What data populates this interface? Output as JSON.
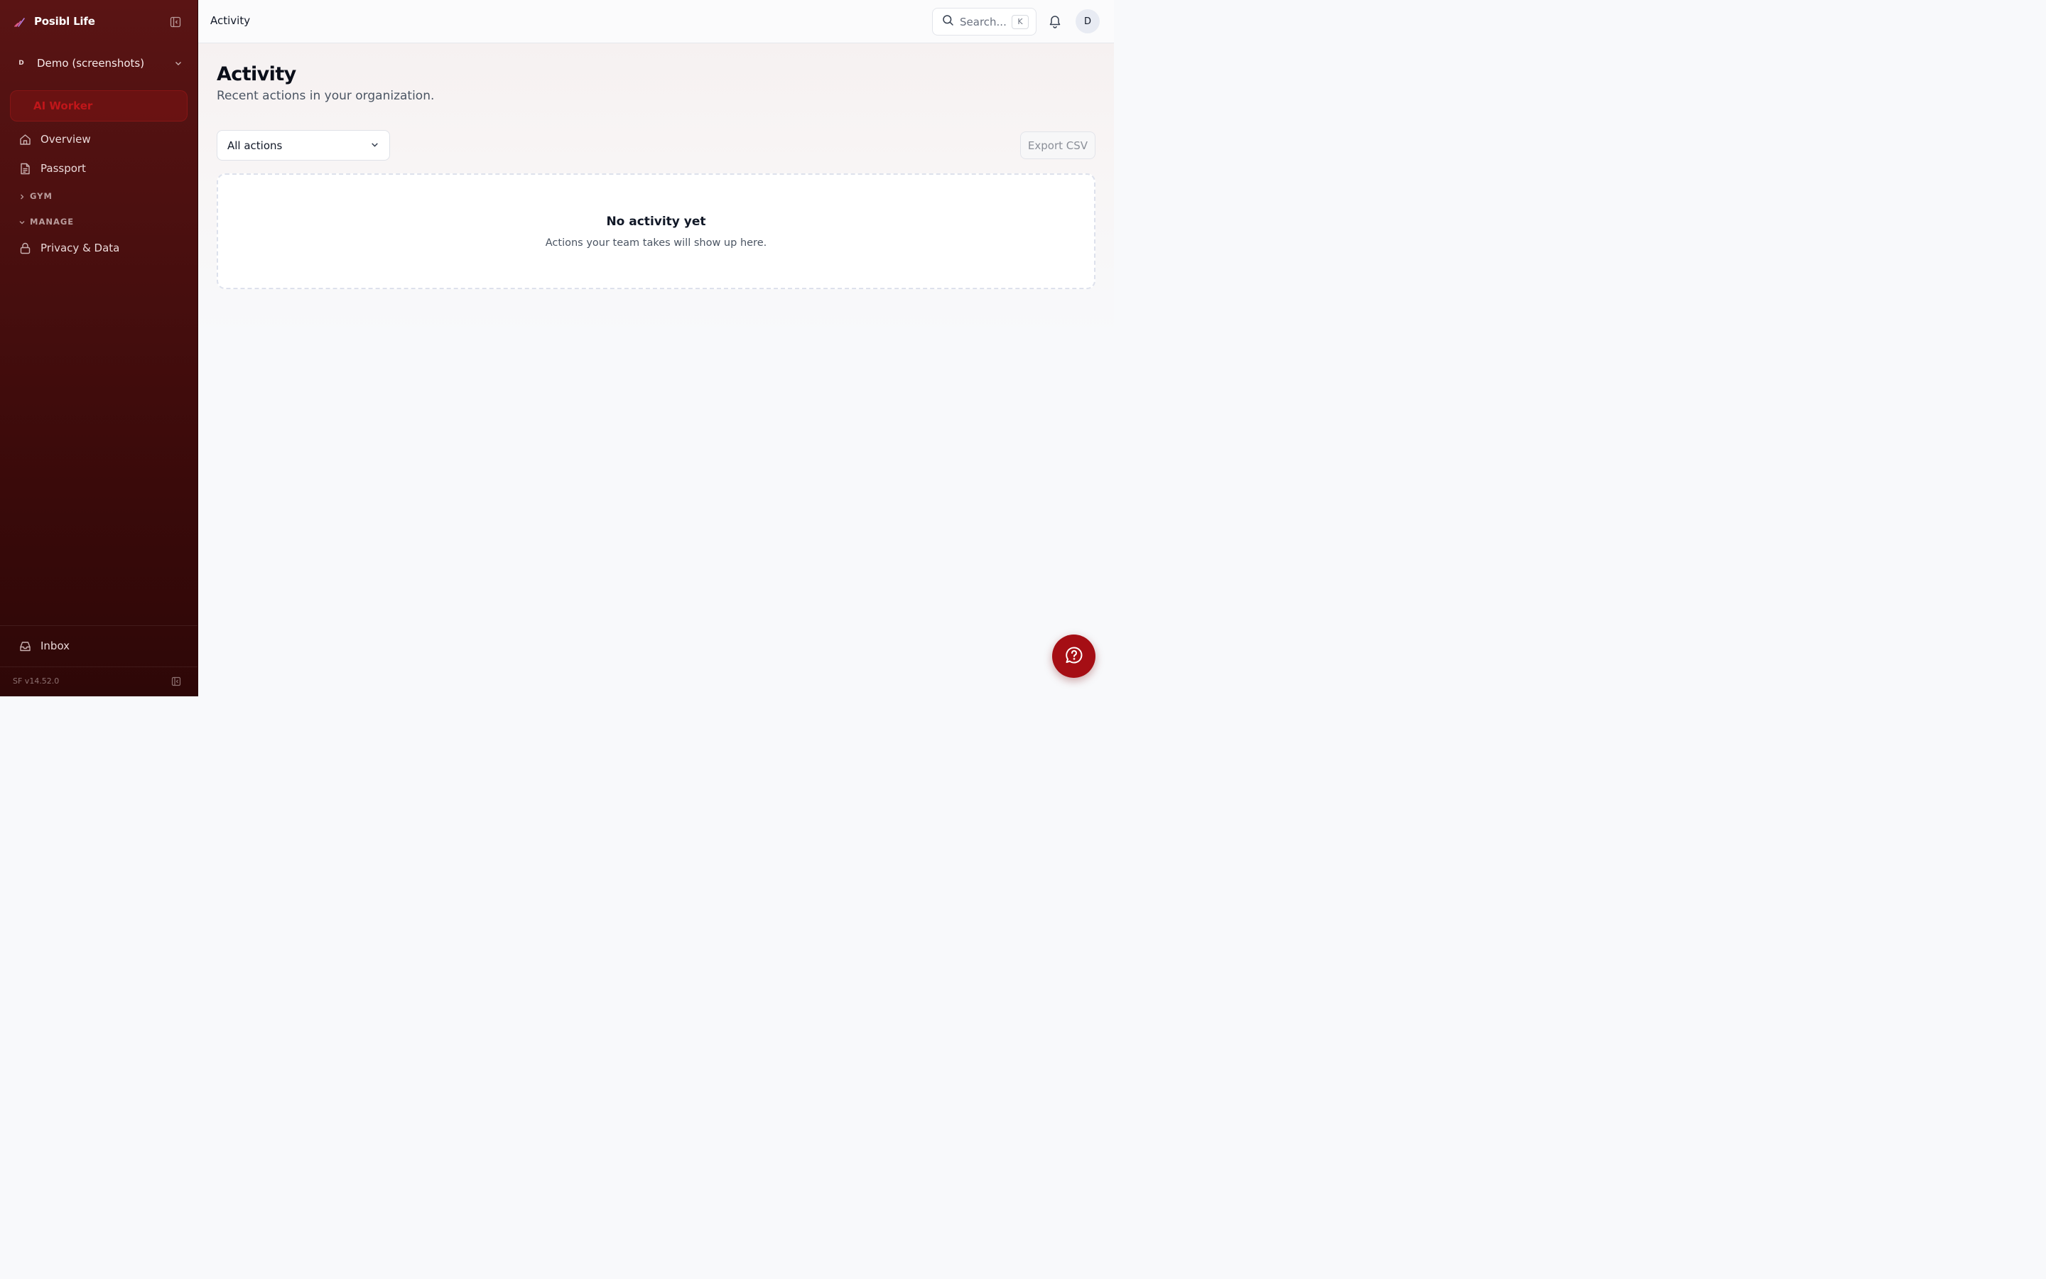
{
  "app": {
    "brand_name": "Posibl Life",
    "version": "SF v14.52.0"
  },
  "sidebar": {
    "org": {
      "avatar_letter": "D",
      "name": "Demo (screenshots)"
    },
    "ai_worker_label": "AI Worker",
    "items": [
      {
        "label": "Overview",
        "icon": "home-icon"
      },
      {
        "label": "Passport",
        "icon": "document-icon"
      }
    ],
    "sections": [
      {
        "label": "GYM",
        "expanded": false
      },
      {
        "label": "MANAGE",
        "expanded": true,
        "items": [
          {
            "label": "Privacy & Data",
            "icon": "lock-icon"
          }
        ]
      }
    ],
    "bottom_item": {
      "label": "Inbox",
      "icon": "inbox-icon"
    }
  },
  "topbar": {
    "title": "Activity",
    "search_placeholder": "Search...",
    "search_shortcut": "K",
    "user_avatar_letter": "D"
  },
  "main": {
    "title": "Activity",
    "subtitle": "Recent actions in your organization.",
    "filter": {
      "selected": "All actions"
    },
    "export_label": "Export CSV",
    "empty_state": {
      "title": "No activity yet",
      "description": "Actions your team takes will show up here."
    }
  },
  "colors": {
    "sidebar_top": "#5a1414",
    "sidebar_bottom": "#2e0707",
    "accent": "#c0161a",
    "fab": "#a50e14"
  }
}
